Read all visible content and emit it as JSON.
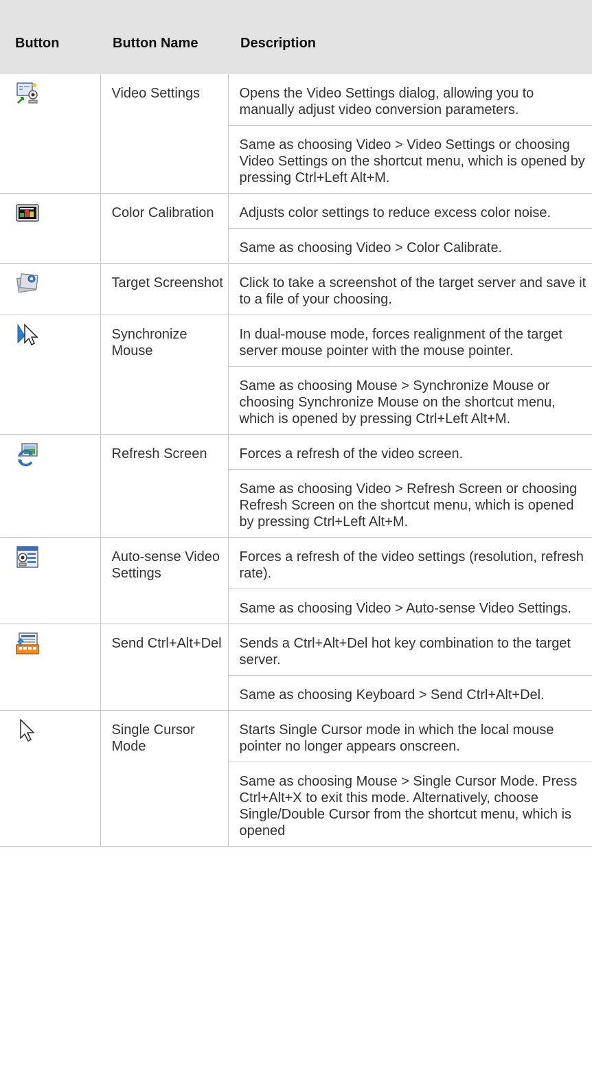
{
  "table": {
    "headers": {
      "button": "Button",
      "name": "Button Name",
      "description": "Description"
    },
    "rows": [
      {
        "icon": "video-settings-icon",
        "name": "Video Settings",
        "paras": [
          "Opens the Video Settings dialog, allowing you to manually adjust video conversion parameters.",
          "Same as choosing Video > Video Settings or choosing Video Settings on the shortcut menu, which is opened by pressing Ctrl+Left Alt+M."
        ]
      },
      {
        "icon": "color-calibration-icon",
        "name": "Color Calibration",
        "paras": [
          "Adjusts color settings to reduce excess color noise.",
          "Same as choosing Video > Color Calibrate."
        ]
      },
      {
        "icon": "target-screenshot-icon",
        "name": "Target Screenshot",
        "paras": [
          "Click to take a screenshot of the target server and save it to a file of your choosing."
        ]
      },
      {
        "icon": "synchronize-mouse-icon",
        "name": "Synchronize Mouse",
        "paras": [
          "In dual-mouse mode, forces realignment of the target server mouse pointer with the mouse pointer.",
          "Same as choosing Mouse > Synchronize Mouse or choosing Synchronize Mouse on the shortcut menu, which is opened by pressing Ctrl+Left Alt+M."
        ]
      },
      {
        "icon": "refresh-screen-icon",
        "name": "Refresh Screen",
        "paras": [
          "Forces a refresh of the video screen.",
          "Same as choosing Video > Refresh Screen or choosing Refresh Screen on the shortcut menu, which is opened by pressing Ctrl+Left Alt+M."
        ]
      },
      {
        "icon": "auto-sense-video-settings-icon",
        "name": "Auto-sense Video Settings",
        "paras": [
          "Forces a refresh of the video settings (resolution, refresh rate).",
          "Same as choosing Video > Auto-sense Video Settings."
        ]
      },
      {
        "icon": "send-ctrl-alt-del-icon",
        "name": "Send Ctrl+Alt+Del",
        "paras": [
          "Sends a Ctrl+Alt+Del hot key combination to the target server.",
          "Same as choosing Keyboard > Send Ctrl+Alt+Del."
        ]
      },
      {
        "icon": "single-cursor-mode-icon",
        "name": "Single Cursor Mode",
        "paras": [
          "Starts Single Cursor mode in which the local mouse pointer no longer appears onscreen.",
          "Same as choosing Mouse > Single Cursor Mode. Press Ctrl+Alt+X to exit this mode. Alternatively, choose Single/Double Cursor from the shortcut menu, which is opened"
        ]
      }
    ]
  }
}
